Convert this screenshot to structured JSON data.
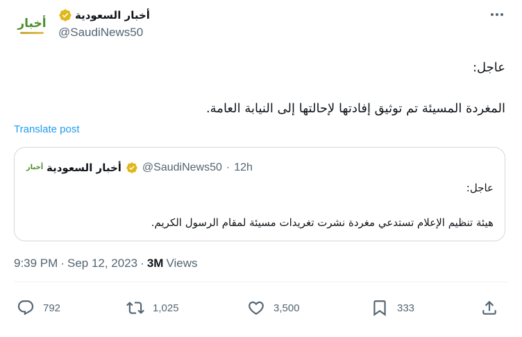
{
  "account": {
    "display_name": "أخبار السعودية",
    "handle": "@SaudiNews50",
    "avatar_text": "أخبار"
  },
  "tweet": {
    "line1": "عاجل:",
    "line2": "المغردة المسيئة تم توثيق إفادتها لإحالتها إلى النيابة العامة.",
    "translate_label": "Translate post"
  },
  "quote": {
    "display_name": "أخبار السعودية",
    "handle": "@SaudiNews50",
    "separator": "·",
    "time": "12h",
    "line1": "عاجل:",
    "line2": "هيئة تنظيم الإعلام تستدعي مغردة نشرت تغريدات مسيئة لمقام الرسول الكريم."
  },
  "meta": {
    "time": "9:39 PM",
    "separator": "·",
    "date": "Sep 12, 2023",
    "separator2": "·",
    "views_count": "3M",
    "views_label": "Views"
  },
  "actions": {
    "replies": "792",
    "reposts": "1,025",
    "likes": "3,500",
    "bookmarks": "333"
  },
  "colors": {
    "accent": "#1d9bf0",
    "verified": "#e2b719",
    "muted": "#536471",
    "border": "#cfd9de"
  }
}
